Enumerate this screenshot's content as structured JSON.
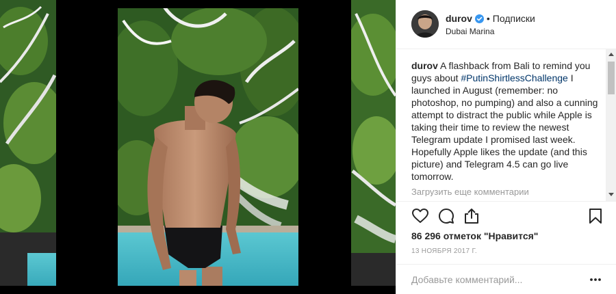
{
  "post": {
    "image_alt": "Shirtless man standing by a turquoise pool framed by dark pillars and tropical plants"
  },
  "header": {
    "username": "durov",
    "verified": true,
    "separator": "•",
    "follow_label": "Подписки",
    "location": "Dubai Marina",
    "avatar_icon": "user-avatar-icon",
    "verified_icon": "verified-badge-icon"
  },
  "caption": {
    "username": "durov",
    "text_before": "A flashback from Bali to remind you guys about ",
    "hashtag": "#PutinShirtlessChallenge",
    "text_after": " I launched in August (remember: no photoshop, no pumping) and also a cunning attempt to distract the public while Apple is taking their time to review the newest Telegram update I promised last week. Hopefully Apple likes the update (and this picture) and Telegram 4.5 can go live tomorrow."
  },
  "comments": {
    "load_more_label": "Загрузить еще комментарии",
    "partial_row_text": "... ... . ."
  },
  "actions": {
    "like_icon": "heart-icon",
    "comment_icon": "comment-bubble-icon",
    "share_icon": "share-icon",
    "save_icon": "bookmark-icon"
  },
  "likes": {
    "text": "86 296 отметок \"Нравится\""
  },
  "date": {
    "text": "13 ноября 2017 г."
  },
  "add_comment": {
    "placeholder": "Добавьте комментарий...",
    "more_icon": "more-options-icon"
  },
  "colors": {
    "text": "#262626",
    "muted": "#999999",
    "hashtag": "#003569",
    "verified_blue": "#3897f0",
    "pool": "#3fb3c3",
    "border": "#efefef"
  }
}
